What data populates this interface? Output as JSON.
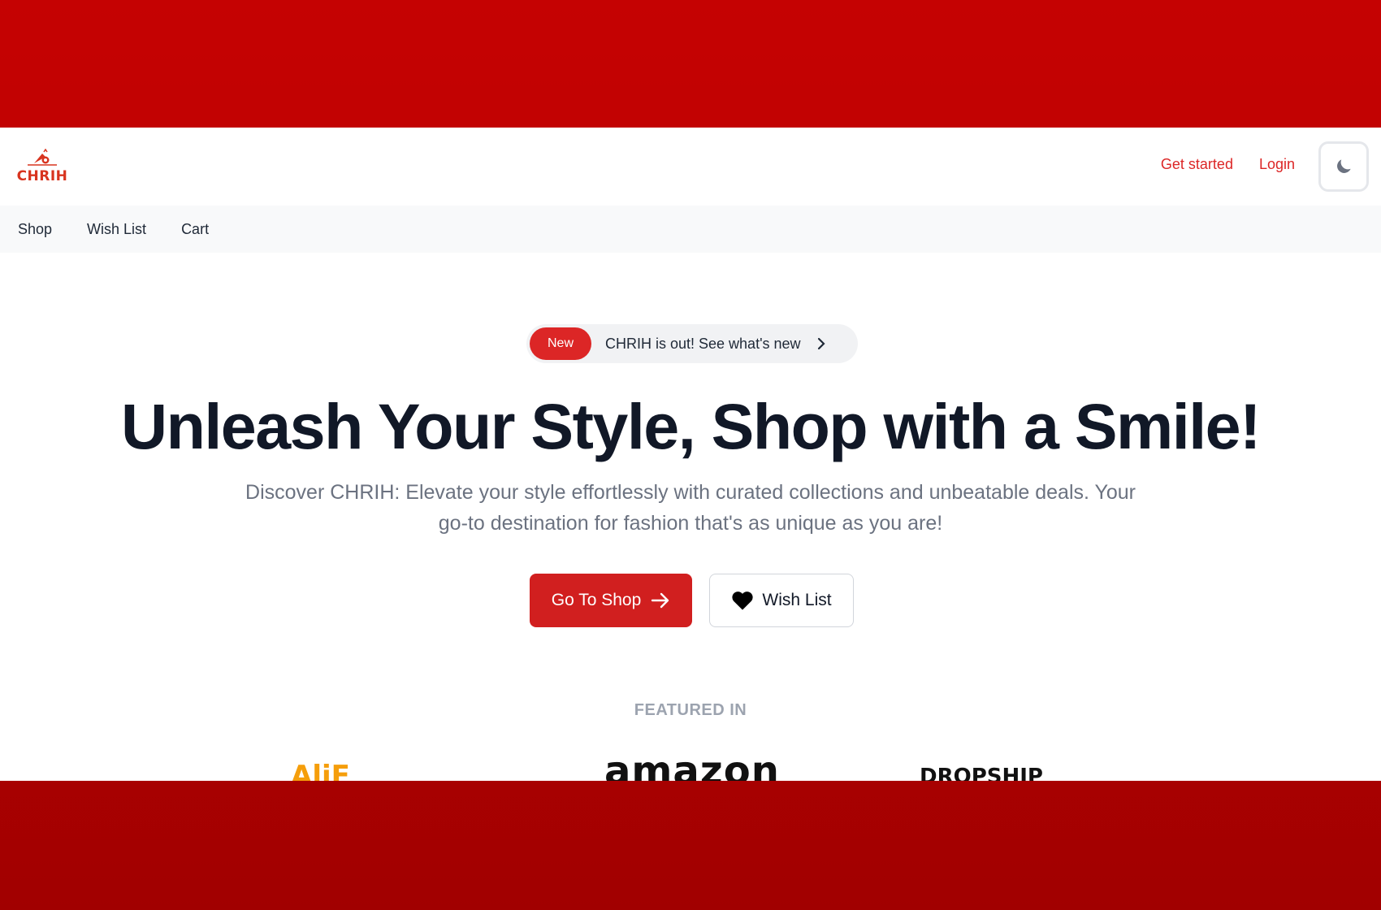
{
  "brand": {
    "name": "CHRIH",
    "accent": "#dc2626"
  },
  "header": {
    "links": [
      "Get started",
      "Login"
    ],
    "theme_toggle_icon": "moon-icon"
  },
  "nav": {
    "items": [
      "Shop",
      "Wish List",
      "Cart"
    ]
  },
  "hero": {
    "badge": "New",
    "announcement": "CHRIH is out! See what's new",
    "headline": "Unleash Your Style, Shop with a Smile!",
    "subcopy": "Discover CHRIH: Elevate your style effortlessly with curated collections and unbeatable deals. Your go-to destination for fashion that's as unique as you are!",
    "primary_button": "Go To Shop",
    "secondary_button": "Wish List"
  },
  "featured": {
    "heading": "FEATURED IN",
    "partners": [
      "AliE",
      "amazon",
      "DROPSHIP"
    ]
  }
}
